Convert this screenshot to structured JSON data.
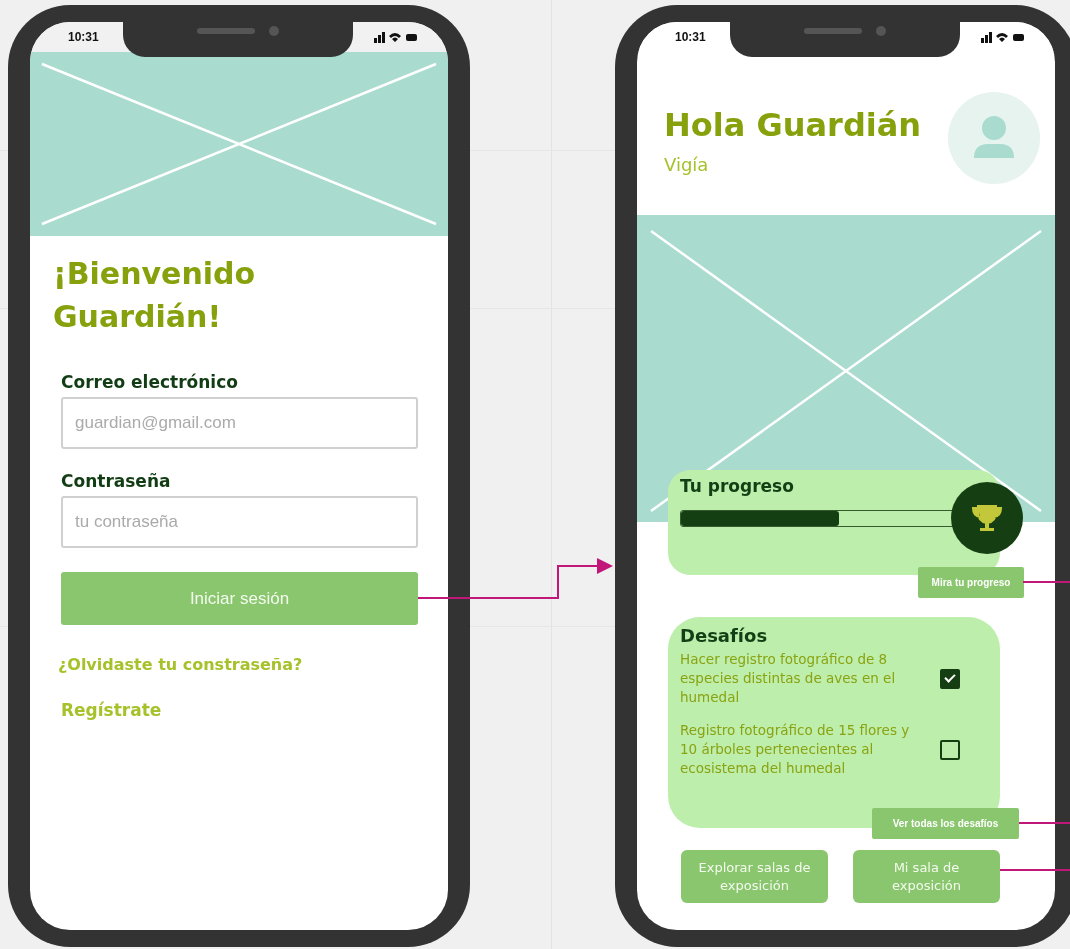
{
  "screens": [
    {
      "kind": "login",
      "status_time": "10:31",
      "title": "¡Bienvenido Guardián!",
      "fields": [
        {
          "label": "Correo electrónico",
          "placeholder": "guardian@gmail.com"
        },
        {
          "label": "Contraseña",
          "placeholder": "tu contraseña"
        }
      ],
      "button": "Iniciar sesión",
      "links": [
        "¿Olvidaste tu constraseña?",
        "Regístrate"
      ]
    },
    {
      "kind": "home",
      "status_time": "10:31",
      "title": "Hola Guardián",
      "subtitle": "Vigía",
      "progress": {
        "title": "Tu progreso",
        "level": 0.58,
        "button": "Mira tu progreso"
      },
      "challenges": {
        "title": "Desafíos",
        "items": [
          {
            "text": "Hacer registro fotográfico de 8 especies distintas de aves en el humedal",
            "checked": true
          },
          {
            "text": "Registro fotográfico de 15 flores y 10 árboles pertenecientes al ecosistema del humedal",
            "checked": false
          }
        ],
        "button": "Ver todas los desafíos"
      },
      "buttons": [
        "Explorar salas de exposición",
        "Mi sala de exposición"
      ]
    }
  ]
}
